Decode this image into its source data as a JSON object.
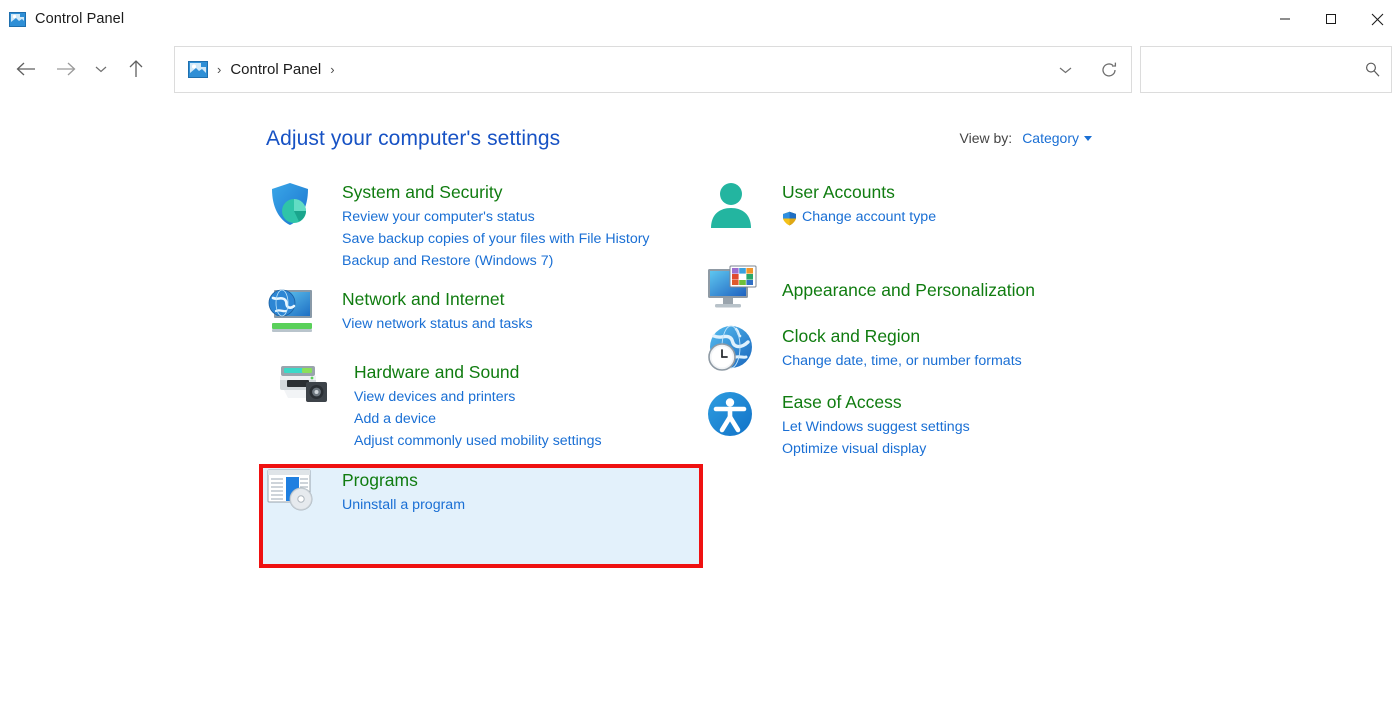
{
  "window": {
    "title": "Control Panel",
    "app_icon": "control-panel-icon",
    "controls": {
      "minimize": "minimize",
      "maximize": "maximize",
      "close": "close"
    }
  },
  "toolbar": {
    "back": "back-arrow",
    "forward": "forward-arrow",
    "recent": "recent-locations-chevron",
    "up": "up-arrow",
    "breadcrumb": {
      "icon": "control-panel-icon",
      "separator": "›",
      "items": [
        "Control Panel"
      ],
      "trailing_separator": "›"
    },
    "address_chevron": "chevron-down-icon",
    "refresh": "refresh-icon",
    "search": {
      "value": "",
      "placeholder": "",
      "icon": "search-icon"
    }
  },
  "main": {
    "page_title": "Adjust your computer's settings",
    "view_by": {
      "label": "View by:",
      "value": "Category",
      "caret": "chevron-down-icon"
    },
    "left_column": [
      {
        "icon": "shield-security-icon",
        "title": "System and Security",
        "links": [
          "Review your computer's status",
          "Save backup copies of your files with File History",
          "Backup and Restore (Windows 7)"
        ]
      },
      {
        "icon": "network-globe-monitor-icon",
        "title": "Network and Internet",
        "links": [
          "View network status and tasks"
        ]
      },
      {
        "icon": "printer-device-icon",
        "title": "Hardware and Sound",
        "links": [
          "View devices and printers",
          "Add a device",
          "Adjust commonly used mobility settings"
        ],
        "highlighted": true
      },
      {
        "icon": "programs-disc-icon",
        "title": "Programs",
        "links": [
          "Uninstall a program"
        ]
      }
    ],
    "right_column": [
      {
        "icon": "user-person-icon",
        "title": "User Accounts",
        "links": [
          "Change account type"
        ],
        "link_icons": [
          "uac-shield-icon"
        ]
      },
      {
        "icon": "monitor-colors-icon",
        "title": "Appearance and Personalization",
        "links": []
      },
      {
        "icon": "clock-globe-icon",
        "title": "Clock and Region",
        "links": [
          "Change date, time, or number formats"
        ]
      },
      {
        "icon": "ease-of-access-icon",
        "title": "Ease of Access",
        "links": [
          "Let Windows suggest settings",
          "Optimize visual display"
        ]
      }
    ]
  },
  "colors": {
    "category_title_green": "#107c10",
    "link_blue": "#1a6fd4",
    "page_title_blue": "#1752c4",
    "highlight_border_red": "#ef1111",
    "highlight_fill_blue": "#e3f1fb"
  }
}
